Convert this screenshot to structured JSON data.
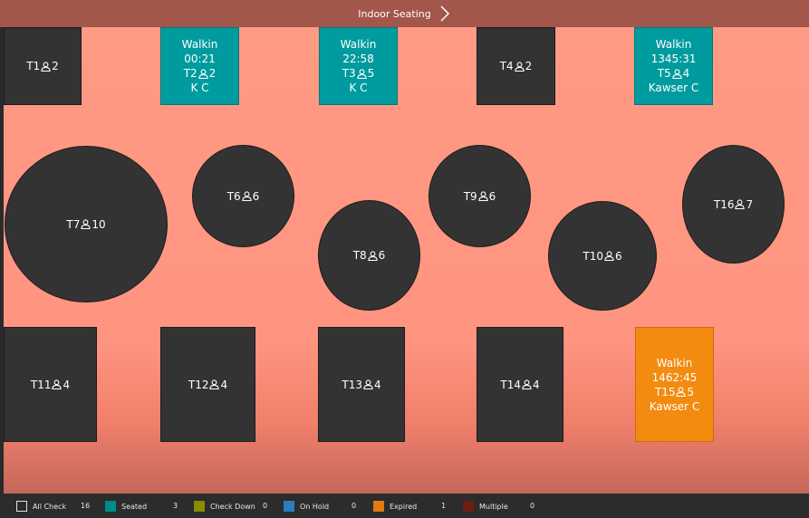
{
  "header": {
    "title": "Indoor Seating"
  },
  "tables": [
    {
      "id": "t1",
      "label": "T1",
      "seats": "2",
      "status": "empty"
    },
    {
      "id": "t2",
      "label": "T2",
      "seats": "2",
      "status": "seated",
      "party": "Walkin",
      "time": "00:21",
      "server": "K C"
    },
    {
      "id": "t3",
      "label": "T3",
      "seats": "5",
      "status": "seated",
      "party": "Walkin",
      "time": "22:58",
      "server": "K C"
    },
    {
      "id": "t4",
      "label": "T4",
      "seats": "2",
      "status": "empty"
    },
    {
      "id": "t5",
      "label": "T5",
      "seats": "4",
      "status": "seated",
      "party": "Walkin",
      "time": "1345:31",
      "server": "Kawser C"
    },
    {
      "id": "t7",
      "label": "T7",
      "seats": "10",
      "status": "empty"
    },
    {
      "id": "t6",
      "label": "T6",
      "seats": "6",
      "status": "empty"
    },
    {
      "id": "t8",
      "label": "T8",
      "seats": "6",
      "status": "empty"
    },
    {
      "id": "t9",
      "label": "T9",
      "seats": "6",
      "status": "empty"
    },
    {
      "id": "t10",
      "label": "T10",
      "seats": "6",
      "status": "empty"
    },
    {
      "id": "t16",
      "label": "T16",
      "seats": "7",
      "status": "empty"
    },
    {
      "id": "t11",
      "label": "T11",
      "seats": "4",
      "status": "empty"
    },
    {
      "id": "t12",
      "label": "T12",
      "seats": "4",
      "status": "empty"
    },
    {
      "id": "t13",
      "label": "T13",
      "seats": "4",
      "status": "empty"
    },
    {
      "id": "t14",
      "label": "T14",
      "seats": "4",
      "status": "empty"
    },
    {
      "id": "t15",
      "label": "T15",
      "seats": "5",
      "status": "expired",
      "party": "Walkin",
      "time": "1462:45",
      "server": "Kawser C"
    }
  ],
  "legend": [
    {
      "label": "All Check",
      "count": "16",
      "color": "#2c2c2c"
    },
    {
      "label": "Seated",
      "count": "3",
      "color": "#008b8b"
    },
    {
      "label": "Check Down",
      "count": "0",
      "color": "#8b8b00"
    },
    {
      "label": "On Hold",
      "count": "0",
      "color": "#2a7fc0"
    },
    {
      "label": "Expired",
      "count": "1",
      "color": "#e07c10"
    },
    {
      "label": "Multiple",
      "count": "0",
      "color": "#6b1e14"
    }
  ],
  "colors": {
    "floor": "#ff9a84",
    "header": "#a3564a",
    "table": "#333333",
    "seated": "#009b9e",
    "expired": "#f28b10"
  }
}
